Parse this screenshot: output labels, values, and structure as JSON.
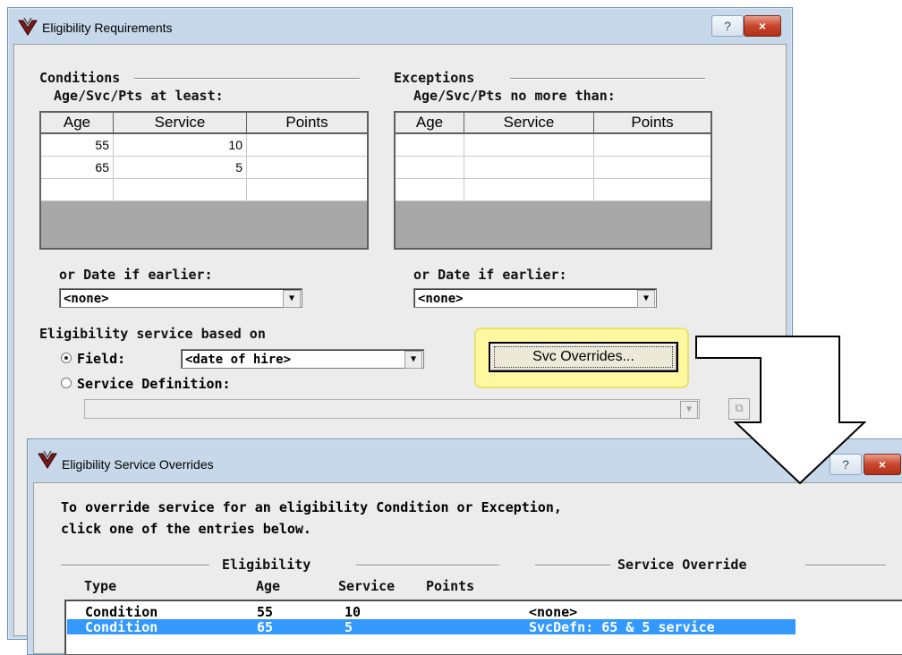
{
  "main_window": {
    "title": "Eligibility Requirements",
    "help_button": "?",
    "close_button": "×",
    "conditions": {
      "group_label": "Conditions",
      "subtitle": "Age/Svc/Pts at least:",
      "columns": [
        "Age",
        "Service",
        "Points"
      ],
      "rows": [
        [
          "55",
          "10",
          ""
        ],
        [
          "65",
          "5",
          ""
        ],
        [
          "",
          "",
          ""
        ]
      ],
      "date_label": "or Date if earlier:",
      "date_value": "<none>"
    },
    "exceptions": {
      "group_label": "Exceptions",
      "subtitle": "Age/Svc/Pts no more than:",
      "columns": [
        "Age",
        "Service",
        "Points"
      ],
      "rows": [
        [
          "",
          "",
          ""
        ],
        [
          "",
          "",
          ""
        ],
        [
          "",
          "",
          ""
        ]
      ],
      "date_label": "or Date if earlier:",
      "date_value": "<none>"
    },
    "service_basis_label": "Eligibility service based on",
    "field_radio_label": "Field:",
    "field_value": "<date of hire>",
    "svcdef_radio_label": "Service Definition:",
    "svcdef_value": "",
    "svc_overrides_button": "Svc Overrides..."
  },
  "overrides_window": {
    "title": "Eligibility Service Overrides",
    "help_button": "?",
    "close_button": "×",
    "instruction_line1": "To override service for an eligibility Condition or Exception,",
    "instruction_line2": "click one of the entries below.",
    "eligibility_group": "Eligibility",
    "override_group": "Service Override",
    "columns": [
      "Type",
      "Age",
      "Service",
      "Points"
    ],
    "rows": [
      {
        "type": "Condition",
        "age": "55",
        "service": "10",
        "points": "",
        "override": "<none>",
        "selected": false
      },
      {
        "type": "Condition",
        "age": "65",
        "service": "5",
        "points": "",
        "override": "SvcDefn: 65 & 5 service",
        "selected": true
      }
    ]
  },
  "colors": {
    "highlight": "#fff8a0",
    "selection": "#3399ff",
    "window_frame": "#c6d8ea",
    "close_button": "#c8452c"
  }
}
